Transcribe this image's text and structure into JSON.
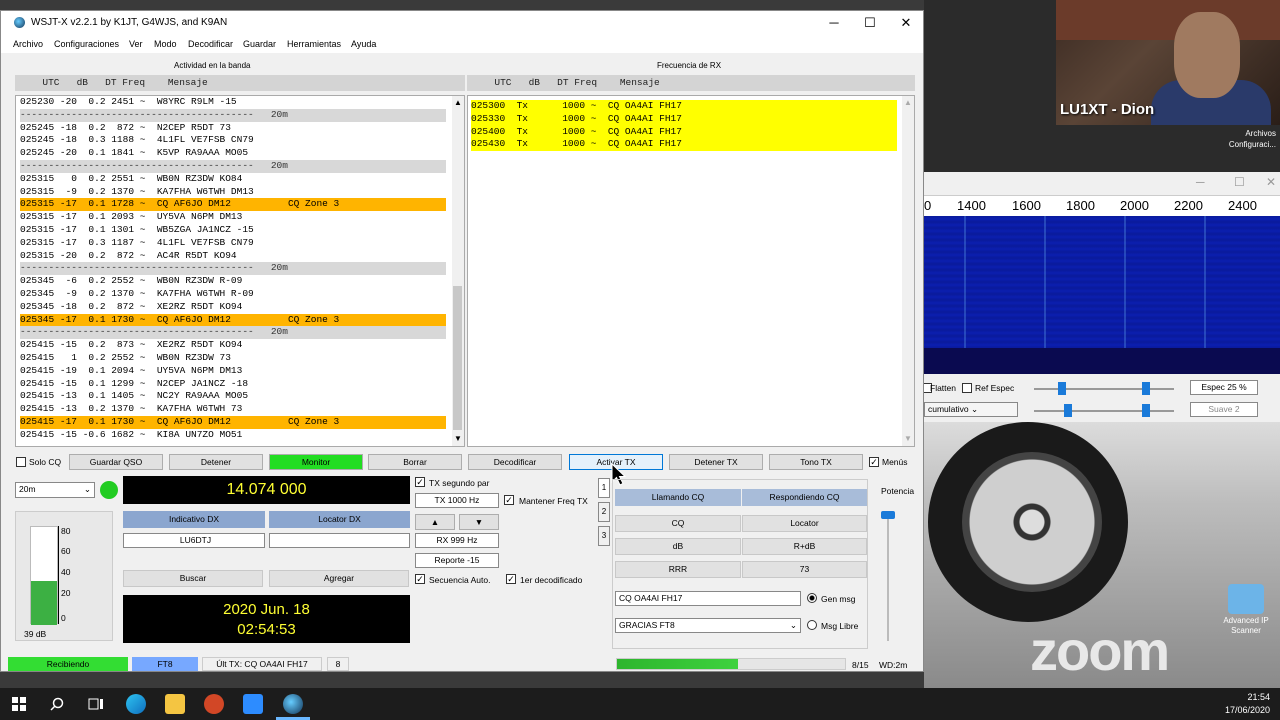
{
  "camera": {
    "name": "LU1XT - Dion"
  },
  "desktop_icons": {
    "top_line1": "Archivos",
    "top_line2": "Configuraci...",
    "adv_line1": "Advanced IP",
    "adv_line2": "Scanner"
  },
  "zoom_logo": "zoom",
  "waterfall": {
    "freq_labels": [
      "0",
      "1400",
      "1600",
      "1800",
      "2000",
      "2200",
      "2400"
    ],
    "flatten_label": "Flatten",
    "ref_espec_label": "Ref Espec",
    "espec_value": "Espec 25 %",
    "cumulative_value": "cumulativo",
    "suave_value": "Suave 2"
  },
  "window": {
    "title": "WSJT-X   v2.2.1   by K1JT, G4WJS, and K9AN",
    "minimize": "─",
    "maximize": "☐",
    "close": "✕"
  },
  "menu": [
    "Archivo",
    "Configuraciones",
    "Ver",
    "Modo",
    "Decodificar",
    "Guardar",
    "Herramientas",
    "Ayuda"
  ],
  "band_activity": {
    "title": "Actividad en la banda",
    "header": "  UTC   dB   DT Freq    Mensaje",
    "rows": [
      {
        "t": "row",
        "text": "025230 -20  0.2 2451 ~  W8YRC R9LM -15"
      },
      {
        "t": "sep",
        "text": "-----------------------------------------   20m"
      },
      {
        "t": "row",
        "text": "025245 -18  0.2  872 ~  N2CEP R5DT 73"
      },
      {
        "t": "row",
        "text": "025245 -18  0.3 1188 ~  4L1FL VE7FSB CN79"
      },
      {
        "t": "row",
        "text": "025245 -20  0.1 1841 ~  K5VP RA9AAA MO05"
      },
      {
        "t": "sep",
        "text": "-----------------------------------------   20m"
      },
      {
        "t": "row",
        "text": "025315   0  0.2 2551 ~  WB0N RZ3DW KO84"
      },
      {
        "t": "row",
        "text": "025315  -9  0.2 1370 ~  KA7FHA W6TWH DM13"
      },
      {
        "t": "cq",
        "text": "025315 -17  0.1 1728 ~  CQ AF6JO DM12          CQ Zone 3"
      },
      {
        "t": "row",
        "text": "025315 -17  0.1 2093 ~  UY5VA N6PM DM13"
      },
      {
        "t": "row",
        "text": "025315 -17  0.1 1301 ~  WB5ZGA JA1NCZ -15"
      },
      {
        "t": "row",
        "text": "025315 -17  0.3 1187 ~  4L1FL VE7FSB CN79"
      },
      {
        "t": "row",
        "text": "025315 -20  0.2  872 ~  AC4R R5DT KO94"
      },
      {
        "t": "sep",
        "text": "-----------------------------------------   20m"
      },
      {
        "t": "row",
        "text": "025345  -6  0.2 2552 ~  WB0N RZ3DW R-09"
      },
      {
        "t": "row",
        "text": "025345  -9  0.2 1370 ~  KA7FHA W6TWH R-09"
      },
      {
        "t": "row",
        "text": "025345 -18  0.2  872 ~  XE2RZ R5DT KO94"
      },
      {
        "t": "cq",
        "text": "025345 -17  0.1 1730 ~  CQ AF6JO DM12          CQ Zone 3"
      },
      {
        "t": "sep",
        "text": "-----------------------------------------   20m"
      },
      {
        "t": "row",
        "text": "025415 -15  0.2  873 ~  XE2RZ R5DT KO94"
      },
      {
        "t": "row",
        "text": "025415   1  0.2 2552 ~  WB0N RZ3DW 73"
      },
      {
        "t": "row",
        "text": "025415 -19  0.1 2094 ~  UY5VA N6PM DM13"
      },
      {
        "t": "row",
        "text": "025415 -15  0.1 1299 ~  N2CEP JA1NCZ -18"
      },
      {
        "t": "row",
        "text": "025415 -13  0.1 1405 ~  NC2Y RA9AAA MO05"
      },
      {
        "t": "row",
        "text": "025415 -13  0.2 1370 ~  KA7FHA W6TWH 73"
      },
      {
        "t": "cq",
        "text": "025415 -17  0.1 1730 ~  CQ AF6JO DM12          CQ Zone 3"
      },
      {
        "t": "row",
        "text": "025415 -15 -0.6 1682 ~  KI8A UN7ZO MO51"
      }
    ]
  },
  "rx_frequency": {
    "title": "Frecuencia de RX",
    "header": "  UTC   dB   DT Freq    Mensaje",
    "rows": [
      "025300  Tx      1000 ~  CQ OA4AI FH17",
      "025330  Tx      1000 ~  CQ OA4AI FH17",
      "025400  Tx      1000 ~  CQ OA4AI FH17",
      "025430  Tx      1000 ~  CQ OA4AI FH17"
    ]
  },
  "buttons": {
    "solo_cq": "Solo CQ",
    "guardar_qso": "Guardar QSO",
    "detener": "Detener",
    "monitor": "Monitor",
    "borrar": "Borrar",
    "decodificar": "Decodificar",
    "activar_tx": "Activar TX",
    "detener_tx": "Detener TX",
    "tono_tx": "Tono TX",
    "menus": "Menús"
  },
  "left_controls": {
    "band": "20m",
    "frequency": "14.074 000",
    "indicativo_dx": "Indicativo DX",
    "locator_dx": "Locator DX",
    "dx_call": "LU6DTJ",
    "dx_locator": "",
    "buscar": "Buscar",
    "agregar": "Agregar",
    "date": "2020 Jun. 18",
    "time": "02:54:53",
    "level_db": "39 dB",
    "meter_ticks": [
      "80",
      "60",
      "40",
      "20",
      "0"
    ],
    "meter_level_fraction": 0.45
  },
  "mid_controls": {
    "tx_segundo_par": "TX segundo par",
    "tx_hz": "TX  1000  Hz",
    "mantener_freq_tx": "Mantener Freq TX",
    "up": "▲",
    "down": "▼",
    "rx_hz": "RX  999  Hz",
    "reporte": "Reporte  -15",
    "secuencia_auto": "Secuencia Auto.",
    "primer_decodificado": "1er decodificado",
    "tabs": [
      "1",
      "2",
      "3"
    ]
  },
  "messages_panel": {
    "llamando_cq": "Llamando CQ",
    "respondiendo_cq": "Respondiendo CQ",
    "cq": "CQ",
    "locator": "Locator",
    "db": "dB",
    "r_db": "R+dB",
    "rrr": "RRR",
    "seventy_three": "73",
    "gen_msg_value": "CQ OA4AI FH17",
    "gen_msg_label": "Gen msg",
    "free_msg_value": "GRACIAS FT8",
    "free_msg_label": "Msg Libre",
    "potencia": "Potencia",
    "power_fraction": 0.0
  },
  "status": {
    "receiving": "Recibiendo",
    "mode": "FT8",
    "last_tx": "Últ TX: CQ OA4AI FH17",
    "count": "8",
    "progress_fraction": 0.53,
    "period": "8/15",
    "wd": "WD:2m"
  },
  "clock": {
    "time": "21:54",
    "date": "17/06/2020"
  },
  "colors": {
    "cq_highlight": "#ffb400",
    "tx_highlight": "#ffff00",
    "monitor_green": "#22dd22",
    "freq_display": "#ffff33"
  }
}
